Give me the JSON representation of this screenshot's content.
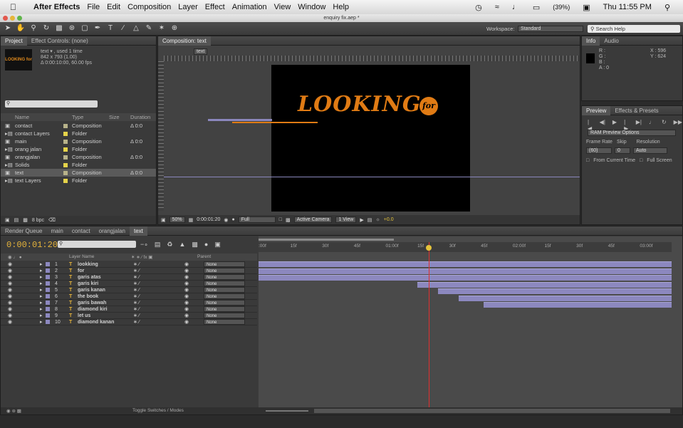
{
  "menubar": {
    "app": "After Effects",
    "items": [
      "File",
      "Edit",
      "Composition",
      "Layer",
      "Effect",
      "Animation",
      "View",
      "Window",
      "Help"
    ],
    "battery": "(39%)",
    "clock": "Thu 11:55 PM"
  },
  "window": {
    "title": "enquiry fix.aep *"
  },
  "toolbar": {
    "workspace_label": "Workspace:",
    "workspace_value": "Standard",
    "search_placeholder": "Search Help"
  },
  "project_panel": {
    "tabs": [
      "Project",
      "Effect Controls: (none)"
    ],
    "item_name": "text ▾ , used 1 time",
    "item_size": "842 x 793 (1.00)",
    "item_duration": "Δ 0:00:10:00, 60.00 fps",
    "thumb_text": "LOOKING for",
    "columns": [
      "Name",
      "Type",
      "Size",
      "Duration"
    ],
    "rows": [
      {
        "name": "contact",
        "type": "Composition",
        "duration": "Δ 0:0",
        "color": "#b7b28a",
        "icon": "comp-icon"
      },
      {
        "name": "contact Layers",
        "type": "Folder",
        "duration": "",
        "color": "#e5d34a",
        "icon": "folder-icon"
      },
      {
        "name": "main",
        "type": "Composition",
        "duration": "Δ 0:0",
        "color": "#b7b28a",
        "icon": "comp-icon"
      },
      {
        "name": "orang jalan",
        "type": "Folder",
        "duration": "",
        "color": "#e5d34a",
        "icon": "folder-icon"
      },
      {
        "name": "orangjalan",
        "type": "Composition",
        "duration": "Δ 0:0",
        "color": "#b7b28a",
        "icon": "comp-icon"
      },
      {
        "name": "Solids",
        "type": "Folder",
        "duration": "",
        "color": "#e5d34a",
        "icon": "folder-icon"
      },
      {
        "name": "text",
        "type": "Composition",
        "duration": "Δ 0:0",
        "color": "#b7b28a",
        "icon": "comp-icon"
      },
      {
        "name": "text Layers",
        "type": "Folder",
        "duration": "",
        "color": "#e5d34a",
        "icon": "folder-icon"
      }
    ],
    "bpc": "8 bpc"
  },
  "comp_panel": {
    "tab": "Composition: text",
    "crumb": "text",
    "looking_text": "LOOKING",
    "for_text": "for",
    "zoom": "50%",
    "timecode": "0:00:01:20",
    "quality": "Full",
    "camera": "Active Camera",
    "view": "1 View",
    "exposure": "+0.0"
  },
  "info_panel": {
    "tabs": [
      "Info",
      "Audio"
    ],
    "r": "R :",
    "g": "G :",
    "b": "B :",
    "a": "A : 0",
    "x": "X : 596",
    "y": "Y : 624"
  },
  "preview_panel": {
    "tabs": [
      "Preview",
      "Effects & Presets"
    ],
    "ram_options": "RAM Preview Options",
    "labels": [
      "Frame Rate",
      "Skip",
      "Resolution"
    ],
    "frame_rate": "(60)",
    "skip": "0",
    "resolution": "Auto",
    "from_current": "From Current Time",
    "full_screen": "Full Screen"
  },
  "timeline": {
    "tabs": [
      "Render Queue",
      "main",
      "contact",
      "orangjalan",
      "text"
    ],
    "timecode": "0:00:01:20",
    "col_layer_name": "Layer Name",
    "col_parent": "Parent",
    "ruler_labels": [
      ":00f",
      "15f",
      "30f",
      "45f",
      "01:00f",
      "15f",
      "30f",
      "45f",
      "02:00f",
      "15f",
      "30f",
      "45f",
      "03:00f"
    ],
    "playhead_fraction": 0.412,
    "layers": [
      {
        "num": "1",
        "name": "lookking",
        "parent": "None",
        "start": 0.0
      },
      {
        "num": "2",
        "name": "for",
        "parent": "None",
        "start": 0.0
      },
      {
        "num": "3",
        "name": "garis atas",
        "parent": "None",
        "start": 0.0
      },
      {
        "num": "4",
        "name": "garis kiri",
        "parent": "None",
        "start": 0.385
      },
      {
        "num": "5",
        "name": "garis kanan",
        "parent": "None",
        "start": 0.435
      },
      {
        "num": "6",
        "name": "the book",
        "parent": "None",
        "start": 0.485
      },
      {
        "num": "7",
        "name": "garis bawah",
        "parent": "None",
        "start": 0.545
      },
      {
        "num": "8",
        "name": "diamond kiri",
        "parent": "None",
        "start": null
      },
      {
        "num": "9",
        "name": "let us",
        "parent": "None",
        "start": null
      },
      {
        "num": "10",
        "name": "diamond kanan",
        "parent": "None",
        "start": null
      }
    ],
    "toggle_label": "Toggle Switches / Modes"
  }
}
